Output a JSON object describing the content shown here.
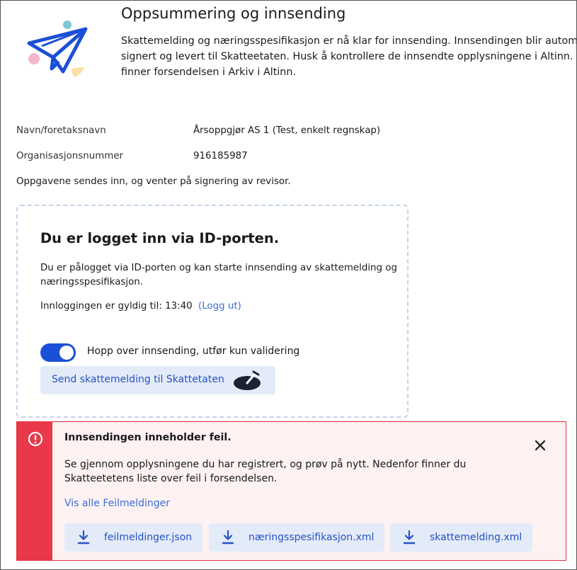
{
  "header": {
    "title": "Oppsummering og innsending",
    "intro_lines": [
      "Skattemelding og næringsspesifikasjon er nå klar for innsending. Innsendingen blir automatisk",
      "signert og levert til Skatteetaten. Husk å kontrollere de innsendte opplysningene i Altinn. Du",
      "finner forsendelsen i Arkiv i Altinn."
    ],
    "icon": "paper-plane-icon"
  },
  "info": {
    "name_label": "Navn/foretaksnavn",
    "name_value": "Årsoppgjør AS 1 (Test, enkelt regnskap)",
    "org_label": "Organisasjonsnummer",
    "org_value": "916185987",
    "note": "Oppgavene sendes inn, og venter på signering av revisor."
  },
  "login": {
    "title": "Du er logget inn via ID-porten.",
    "text_lines": [
      "Du er pålogget via ID-porten og kan starte innsending av skattemelding og",
      "næringsspesifikasjon."
    ],
    "valid_label": "Innloggingen er gyldig til: 13:40",
    "logout_link": "(Logg ut)",
    "toggle_label": "Hopp over innsending, utfør kun validering",
    "toggle_on": true,
    "send_button": "Send skattemelding til Skattetaten"
  },
  "error": {
    "title": "Innsendingen inneholder feil.",
    "text_lines": [
      "Se gjennom opplysningene du har registrert, og prøv på nytt. Nedenfor finner du",
      "Skatteetetens liste over feil i forsendelsen."
    ],
    "show_all_link": "Vis alle Feilmeldinger",
    "downloads": [
      "feilmeldinger.json",
      "næringsspesifikasjon.xml",
      "skattemelding.xml"
    ]
  },
  "colors": {
    "accent": "#1a4fd6",
    "link": "#3a6fd8",
    "button_bg": "#e4ebf8",
    "error_red": "#e8384a",
    "error_bg": "#fdf1f2"
  }
}
